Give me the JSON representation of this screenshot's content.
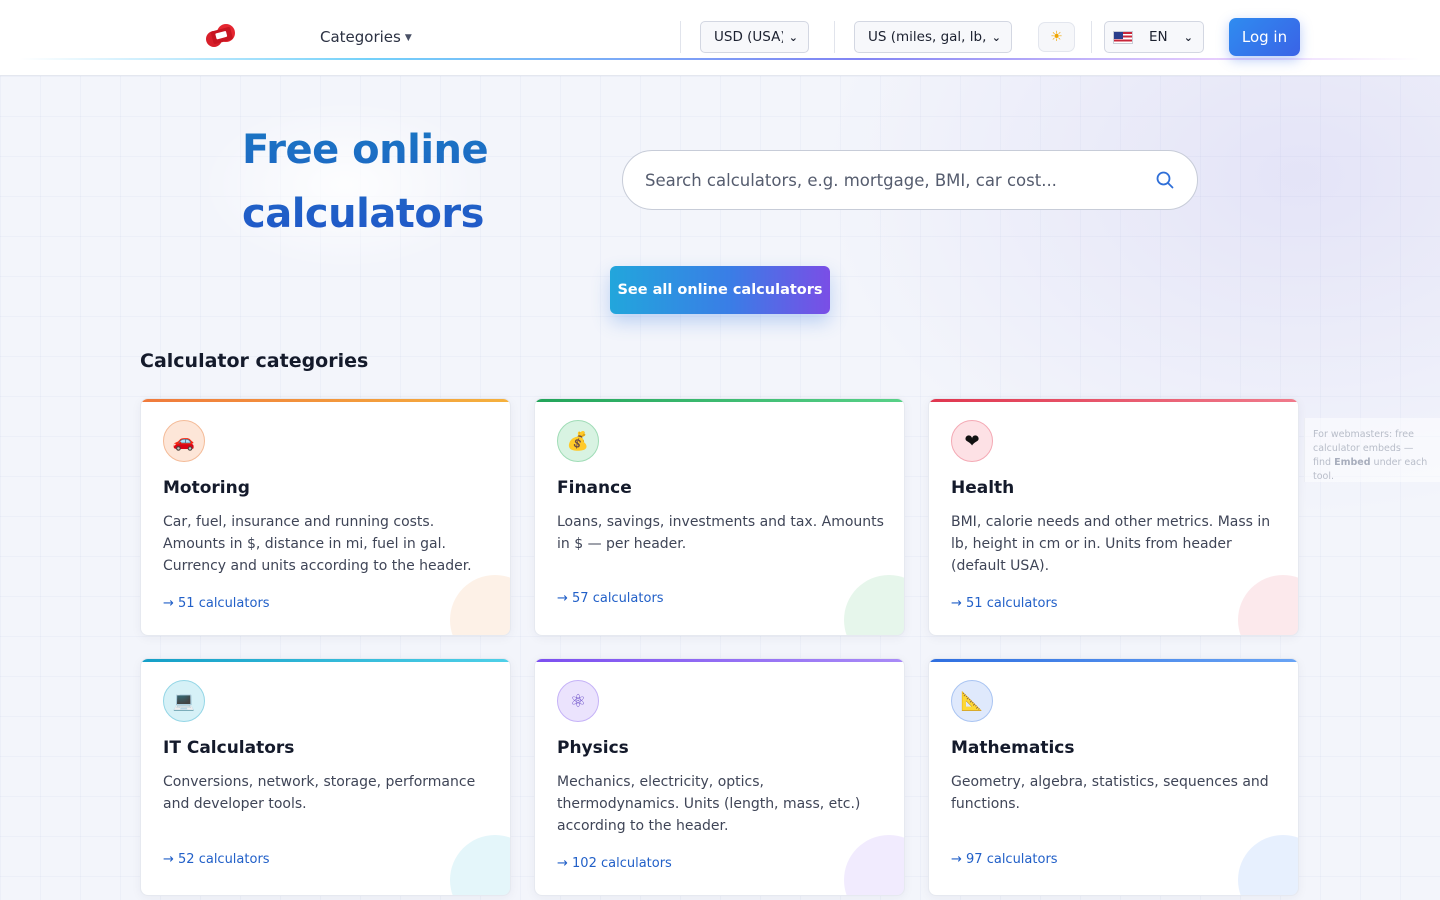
{
  "header": {
    "categories_label": "Categories",
    "currency_select": "USD (USA)",
    "units_select": "US (miles, gal, lb, °F",
    "theme_icon": "sun-icon",
    "language_select": "EN",
    "login_label": "Log in"
  },
  "hero": {
    "title": "Free online calculators",
    "search_placeholder": "Search calculators, e.g. mortgage, BMI, car cost...",
    "see_all_label": "See all online calculators"
  },
  "categories": {
    "title": "Calculator categories",
    "items": [
      {
        "title": "Motoring",
        "icon": "🚗",
        "description": "Car, fuel, insurance and running costs. Amounts in $, distance in mi, fuel in gal. Currency and units according to the header.",
        "count": "→ 51 calculators",
        "color": "#f08a3c"
      },
      {
        "title": "Finance",
        "icon": "💰",
        "description": "Loans, savings, investments and tax. Amounts in $ — per header.",
        "count": "→ 57 calculators",
        "color": "#2fb35e"
      },
      {
        "title": "Health",
        "icon": "❤",
        "description": "BMI, calorie needs and other metrics. Mass in lb, height in cm or in. Units from header (default USA).",
        "count": "→ 51 calculators",
        "color": "#e5485f"
      },
      {
        "title": "IT Calculators",
        "icon": "💻",
        "description": "Conversions, network, storage, performance and developer tools.",
        "count": "→ 52 calculators",
        "color": "#22b3d6"
      },
      {
        "title": "Physics",
        "icon": "⚛",
        "description": "Mechanics, electricity, optics, thermodynamics. Units (length, mass, etc.) according to the header.",
        "count": "→ 102 calculators",
        "color": "#8b5cf6"
      },
      {
        "title": "Mathematics",
        "icon": "📐",
        "description": "Geometry, algebra, statistics, sequences and functions.",
        "count": "→ 97 calculators",
        "color": "#3b82f6"
      }
    ]
  },
  "webmaster_note": {
    "text": "For webmasters: free calculator embeds — find",
    "bold": "Embed",
    "suffix": "under each tool."
  }
}
